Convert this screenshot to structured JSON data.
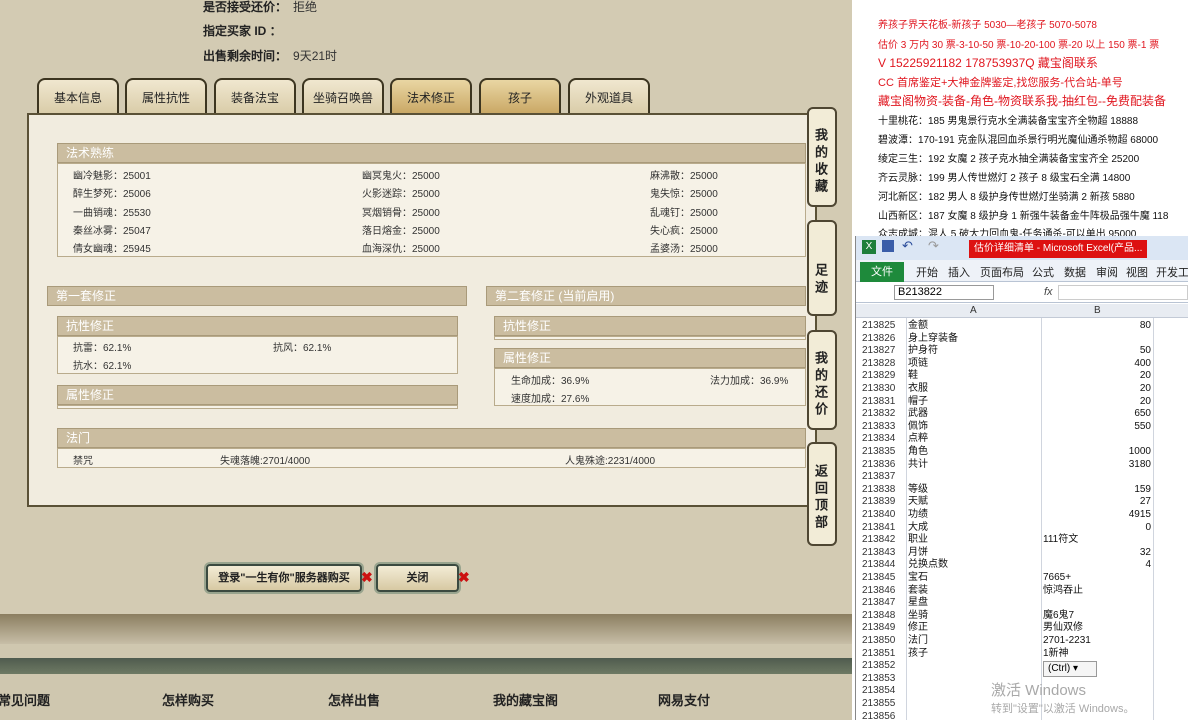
{
  "top": {
    "row1_label": "是否接受还价：",
    "row1_value": "拒绝",
    "row2_label": "指定买家 ID ：",
    "row3_label": "出售剩余时间：",
    "row3_value": "9天21时"
  },
  "tabs": [
    "基本信息",
    "属性抗性",
    "装备法宝",
    "坐骑召唤兽",
    "法术修正",
    "孩子",
    "外观道具"
  ],
  "skills": {
    "title": "法术熟练",
    "rows": [
      [
        "幽冷魅影：25001",
        "幽冥鬼火：25000",
        "麻沸散：25000"
      ],
      [
        "醉生梦死：25006",
        "火影迷踪：25000",
        "鬼失惊：25000"
      ],
      [
        "一曲销魂：25530",
        "冥烟销骨：25000",
        "乱魂钉：25000"
      ],
      [
        "秦丝冰雾：25047",
        "落日熔金：25000",
        "失心疯：25000"
      ],
      [
        "倩女幽魂：25945",
        "血海深仇：25000",
        "孟婆汤：25000"
      ]
    ]
  },
  "set1": {
    "title": "第一套修正",
    "resist_title": "抗性修正",
    "resist": [
      "抗雷：62.1%",
      "抗风：62.1%",
      "抗水：62.1%"
    ],
    "attr_title": "属性修正"
  },
  "set2": {
    "title": "第二套修正 (当前启用)",
    "resist_title": "抗性修正",
    "attr_title": "属性修正",
    "attr": [
      "生命加成：36.9%",
      "法力加成：36.9%",
      "速度加成：27.6%"
    ]
  },
  "fabao": {
    "title": "法门",
    "items": [
      "禁咒",
      "失魂落魄:2701/4000",
      "人鬼殊途:2231/4000"
    ]
  },
  "side_buttons": [
    "我的收藏",
    "足迹",
    "我的还价",
    "返回顶部"
  ],
  "buttons": {
    "buy": "登录\"一生有你\"服务器购买",
    "close": "关闭"
  },
  "footer_links": [
    "常见问题",
    "怎样购买",
    "怎样出售",
    "我的藏宝阁",
    "网易支付"
  ],
  "ad_lines": [
    "养孩子界天花板-新孩子 5030—老孩子 5070-5078",
    "估价 3 万内 30 票-3-10-50 票-10-20-100 票-20 以上 150 票-1 票",
    "V 15225921182    178753937Q    藏宝阁联系",
    "CC 首席鉴定+大神金牌鉴定,找您服务-代合站-单号",
    "藏宝阁物资-装备-角色-物资联系我-抽红包--免费配装备",
    "十里桃花：185 男鬼景行克水全满装备宝宝齐全物超 18888",
    "碧波潭：170-191 克金队混回血杀景行明光魔仙通杀物超 68000",
    "绫定三生：192 女魔 2 孩子克水抽全满装备宝宝齐全 25200",
    "齐云灵脉：199 男人传世燃灯 2 孩子 8 级宝石全满 14800",
    "河北新区：182 男人 8 级护身传世燃灯坐骑满 2 新孩 5880",
    "山西新区：187 女魔 8 级护身 1 新强牛装备金牛阵极品强牛魔 118",
    "众志成城：混人 5 破大力回血鬼-任务通杀-可以单出 95000"
  ],
  "excel": {
    "title": "估价详细清单 - Microsoft Excel(产品...",
    "file_tab": "文件",
    "ribbon_tabs": [
      "开始",
      "插入",
      "页面布局",
      "公式",
      "数据",
      "审阅",
      "视图",
      "开发工具"
    ],
    "name_box": "B213822",
    "fx": "fx",
    "col_a": "A",
    "col_b": "B",
    "rows": [
      [
        "213825",
        "金额",
        "80"
      ],
      [
        "213826",
        "身上穿装备",
        ""
      ],
      [
        "213827",
        "护身符",
        "50"
      ],
      [
        "213828",
        "项链",
        "400"
      ],
      [
        "213829",
        "鞋",
        "20"
      ],
      [
        "213830",
        "衣服",
        "20"
      ],
      [
        "213831",
        "帽子",
        "20"
      ],
      [
        "213832",
        "武器",
        "650"
      ],
      [
        "213833",
        "佩饰",
        "550"
      ],
      [
        "213834",
        "点粹",
        ""
      ],
      [
        "213835",
        "角色",
        "1000"
      ],
      [
        "213836",
        "共计",
        "3180"
      ],
      [
        "213837",
        "",
        ""
      ],
      [
        "213838",
        "等级",
        "159"
      ],
      [
        "213839",
        "天赋",
        "27"
      ],
      [
        "213840",
        "功绩",
        "4915"
      ],
      [
        "213841",
        "大成",
        "0"
      ],
      [
        "213842",
        "职业",
        "111符文"
      ],
      [
        "213843",
        "月饼",
        "32"
      ],
      [
        "213844",
        "兑换点数",
        "4"
      ],
      [
        "213845",
        "宝石",
        "7665+"
      ],
      [
        "213846",
        "套装",
        "惊鸿吞止"
      ],
      [
        "213847",
        "星盘",
        ""
      ],
      [
        "213848",
        "坐骑",
        "魔6鬼7"
      ],
      [
        "213849",
        "修正",
        "男仙双修"
      ],
      [
        "213850",
        "法门",
        "2701-2231"
      ],
      [
        "213851",
        "孩子",
        "1新神"
      ],
      [
        "213852",
        "",
        ""
      ],
      [
        "213853",
        "",
        ""
      ],
      [
        "213854",
        "",
        ""
      ],
      [
        "213855",
        "",
        ""
      ],
      [
        "213856",
        "",
        ""
      ]
    ],
    "ctrl_label": "(Ctrl) ▾",
    "watermark_title": "激活 Windows",
    "watermark_sub": "转到\"设置\"以激活 Windows。"
  }
}
